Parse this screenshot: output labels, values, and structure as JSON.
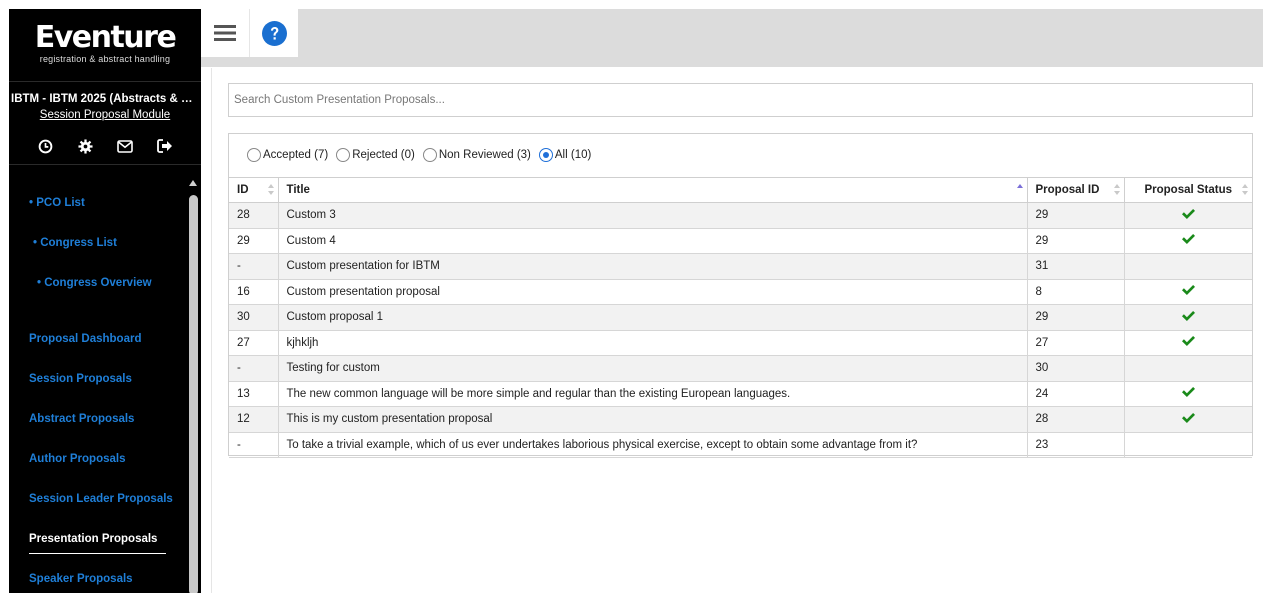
{
  "brand": {
    "name": "Eventure",
    "tagline": "registration & abstract handling"
  },
  "event": {
    "name": "IBTM - IBTM 2025 (Abstracts & Par...",
    "module": "Session Proposal Module"
  },
  "toolbar_icons": [
    "history-icon",
    "gear-icon",
    "mail-icon",
    "logout-icon"
  ],
  "nav": {
    "items": [
      {
        "label": "• PCO List"
      },
      {
        "label": "• Congress List"
      },
      {
        "label": "• Congress Overview"
      },
      {
        "label": "Proposal Dashboard"
      },
      {
        "label": "Session Proposals"
      },
      {
        "label": "Abstract Proposals"
      },
      {
        "label": "Author Proposals"
      },
      {
        "label": "Session Leader Proposals"
      },
      {
        "label": "Presentation Proposals",
        "active": true
      },
      {
        "label": "Speaker Proposals"
      }
    ]
  },
  "topbar": {
    "menu_icon": "hamburger-menu-icon",
    "help_icon": "help-icon"
  },
  "search": {
    "placeholder": "Search Custom Presentation Proposals..."
  },
  "filters": [
    {
      "label": "Accepted (7)",
      "selected": false
    },
    {
      "label": "Rejected (0)",
      "selected": false
    },
    {
      "label": "Non Reviewed (3)",
      "selected": false
    },
    {
      "label": "All (10)",
      "selected": true
    }
  ],
  "table": {
    "columns": [
      "ID",
      "Title",
      "Proposal ID",
      "Proposal Status"
    ],
    "rows": [
      {
        "id": "28",
        "title": "Custom 3",
        "proposal_id": "29",
        "accepted": true
      },
      {
        "id": "29",
        "title": "Custom 4",
        "proposal_id": "29",
        "accepted": true
      },
      {
        "id": "-",
        "title": "Custom presentation for IBTM",
        "proposal_id": "31",
        "accepted": false
      },
      {
        "id": "16",
        "title": "Custom presentation proposal",
        "proposal_id": "8",
        "accepted": true
      },
      {
        "id": "30",
        "title": "Custom proposal 1",
        "proposal_id": "29",
        "accepted": true
      },
      {
        "id": "27",
        "title": "kjhkljh",
        "proposal_id": "27",
        "accepted": true
      },
      {
        "id": "-",
        "title": "Testing for custom",
        "proposal_id": "30",
        "accepted": false
      },
      {
        "id": "13",
        "title": "The new common language will be more simple and regular than the existing European languages.",
        "proposal_id": "24",
        "accepted": true
      },
      {
        "id": "12",
        "title": "This is my custom presentation proposal",
        "proposal_id": "28",
        "accepted": true
      },
      {
        "id": "-",
        "title": "To take a trivial example, which of us ever undertakes laborious physical exercise, except to obtain some advantage from it?",
        "proposal_id": "23",
        "accepted": false
      }
    ]
  },
  "colors": {
    "accent": "#1f7fd8",
    "check": "#1a8a1a",
    "help": "#1a6fd0"
  }
}
